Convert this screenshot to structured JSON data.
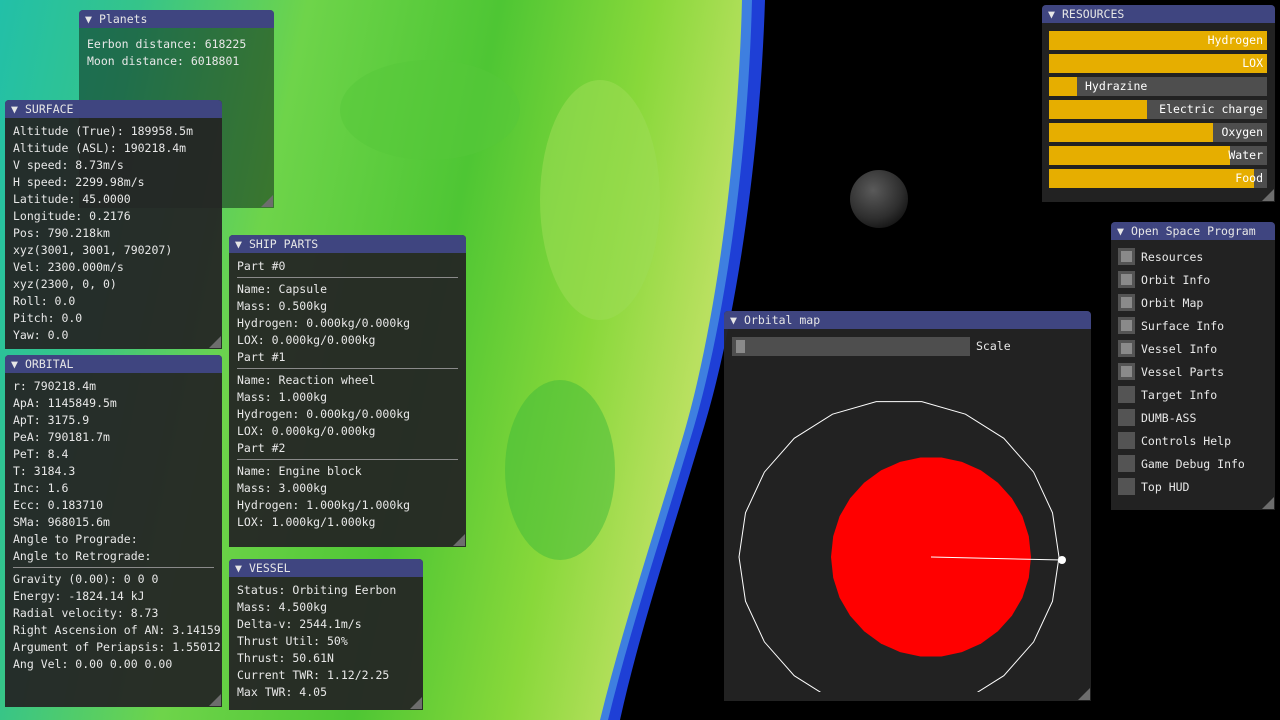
{
  "colors": {
    "title_bar": "#3f4580",
    "window_bg": "#242424",
    "resource_fill": "#e6ae00",
    "planet_red": "#ff0000"
  },
  "planets": {
    "title": "Planets",
    "lines": [
      "Eerbon distance: 618225",
      "Moon distance: 6018801"
    ]
  },
  "surface": {
    "title": "SURFACE",
    "lines": [
      "Altitude (True): 189958.5m",
      "Altitude (ASL): 190218.4m",
      "V speed: 8.73m/s",
      "H speed: 2299.98m/s",
      "Latitude: 45.0000",
      "Longitude: 0.2176",
      "Pos: 790.218km",
      "xyz(3001, 3001, 790207)",
      "Vel: 2300.000m/s",
      "xyz(2300, 0, 0)",
      "Roll: 0.0",
      "Pitch: 0.0",
      "Yaw: 0.0"
    ]
  },
  "orbital": {
    "title": "ORBITAL",
    "lines_top": [
      "r: 790218.4m",
      "ApA: 1145849.5m",
      "ApT: 3175.9",
      "PeA: 790181.7m",
      "PeT: 8.4",
      "T: 3184.3",
      "Inc: 1.6",
      "Ecc: 0.183710",
      "SMa: 968015.6m",
      "Angle to Prograde:",
      "Angle to Retrograde:"
    ],
    "lines_bottom": [
      "Gravity (0.00): 0 0 0",
      "Energy: -1824.14 kJ",
      "Radial velocity: 8.73",
      "Right Ascension of AN: 3.14159",
      "Argument of Periapsis: 1.55012",
      "Ang Vel: 0.00 0.00 0.00"
    ]
  },
  "ship_parts": {
    "title": "SHIP PARTS",
    "parts": [
      {
        "header": "Part #0",
        "lines": [
          "Name: Capsule",
          "Mass: 0.500kg",
          "Hydrogen: 0.000kg/0.000kg",
          "LOX: 0.000kg/0.000kg"
        ]
      },
      {
        "header": "Part #1",
        "lines": [
          "Name: Reaction wheel",
          "Mass: 1.000kg",
          "Hydrogen: 0.000kg/0.000kg",
          "LOX: 0.000kg/0.000kg"
        ]
      },
      {
        "header": "Part #2",
        "lines": [
          "Name: Engine block",
          "Mass: 3.000kg",
          "Hydrogen: 1.000kg/1.000kg",
          "LOX: 1.000kg/1.000kg"
        ]
      }
    ]
  },
  "vessel": {
    "title": "VESSEL",
    "lines": [
      "Status: Orbiting Eerbon",
      "Mass: 4.500kg",
      "Delta-v: 2544.1m/s",
      "Thrust Util: 50%",
      "Thrust: 50.61N",
      "Current TWR: 1.12/2.25",
      "Max TWR: 4.05"
    ]
  },
  "orbital_map": {
    "title": "Orbital map",
    "scale_label": "Scale",
    "scale_value": 0.02,
    "eccentricity": 0.18371
  },
  "resources": {
    "title": "RESOURCES",
    "items": [
      {
        "label": "Hydrogen",
        "fill": 1.0
      },
      {
        "label": "LOX",
        "fill": 1.0
      },
      {
        "label": "Hydrazine",
        "fill": 0.13
      },
      {
        "label": "Electric charge",
        "fill": 0.45
      },
      {
        "label": "Oxygen",
        "fill": 0.75
      },
      {
        "label": "Water",
        "fill": 0.83
      },
      {
        "label": "Food",
        "fill": 0.94
      }
    ]
  },
  "osp": {
    "title": "Open Space Program",
    "items": [
      {
        "label": "Resources",
        "checked": true
      },
      {
        "label": "Orbit Info",
        "checked": true
      },
      {
        "label": "Orbit Map",
        "checked": true
      },
      {
        "label": "Surface Info",
        "checked": true
      },
      {
        "label": "Vessel Info",
        "checked": true
      },
      {
        "label": "Vessel Parts",
        "checked": true
      },
      {
        "label": "Target Info",
        "checked": false
      },
      {
        "label": "DUMB-ASS",
        "checked": false
      },
      {
        "label": "Controls Help",
        "checked": false
      },
      {
        "label": "Game Debug Info",
        "checked": false
      },
      {
        "label": "Top HUD",
        "checked": false
      }
    ]
  }
}
